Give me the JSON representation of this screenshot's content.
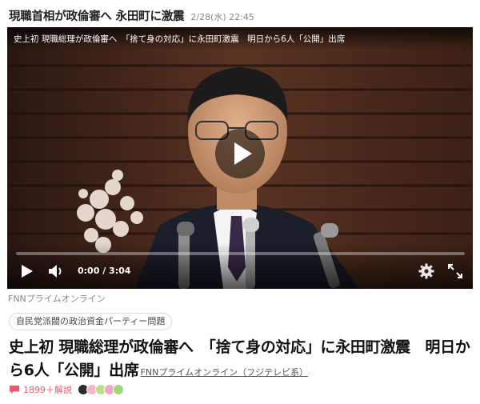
{
  "topic": {
    "title": "現職首相が政倫審へ 永田町に激震",
    "timestamp": "2/28(水) 22:45"
  },
  "video": {
    "title": "史上初 現職総理が政倫審へ　「捨て身の対応」に永田町激震　明日から6人「公開」出席",
    "time_readout": "0:00 / 3:04",
    "progress": 0,
    "icons": {
      "play_big": "play-icon",
      "play_small": "play-icon",
      "volume": "volume-icon",
      "settings": "gear-icon",
      "fullscreen": "fullscreen-icon"
    }
  },
  "source_label": "FNNプライムオンライン",
  "tag": "自民党派閥の政治資金パーティー問題",
  "article": {
    "headline": "史上初 現職総理が政倫審へ　「捨て身の対応」に永田町激震　明日から6人「公開」出席",
    "publisher": "FNNプライムオンライン（フジテレビ系）"
  },
  "comments": {
    "count_label": "1899＋解説",
    "accent_color": "#e85a71",
    "avatar_colors": [
      "#2b2b2b",
      "#f3b5c8",
      "#b8e08a",
      "#f4a6c7",
      "#9fd67a"
    ]
  }
}
